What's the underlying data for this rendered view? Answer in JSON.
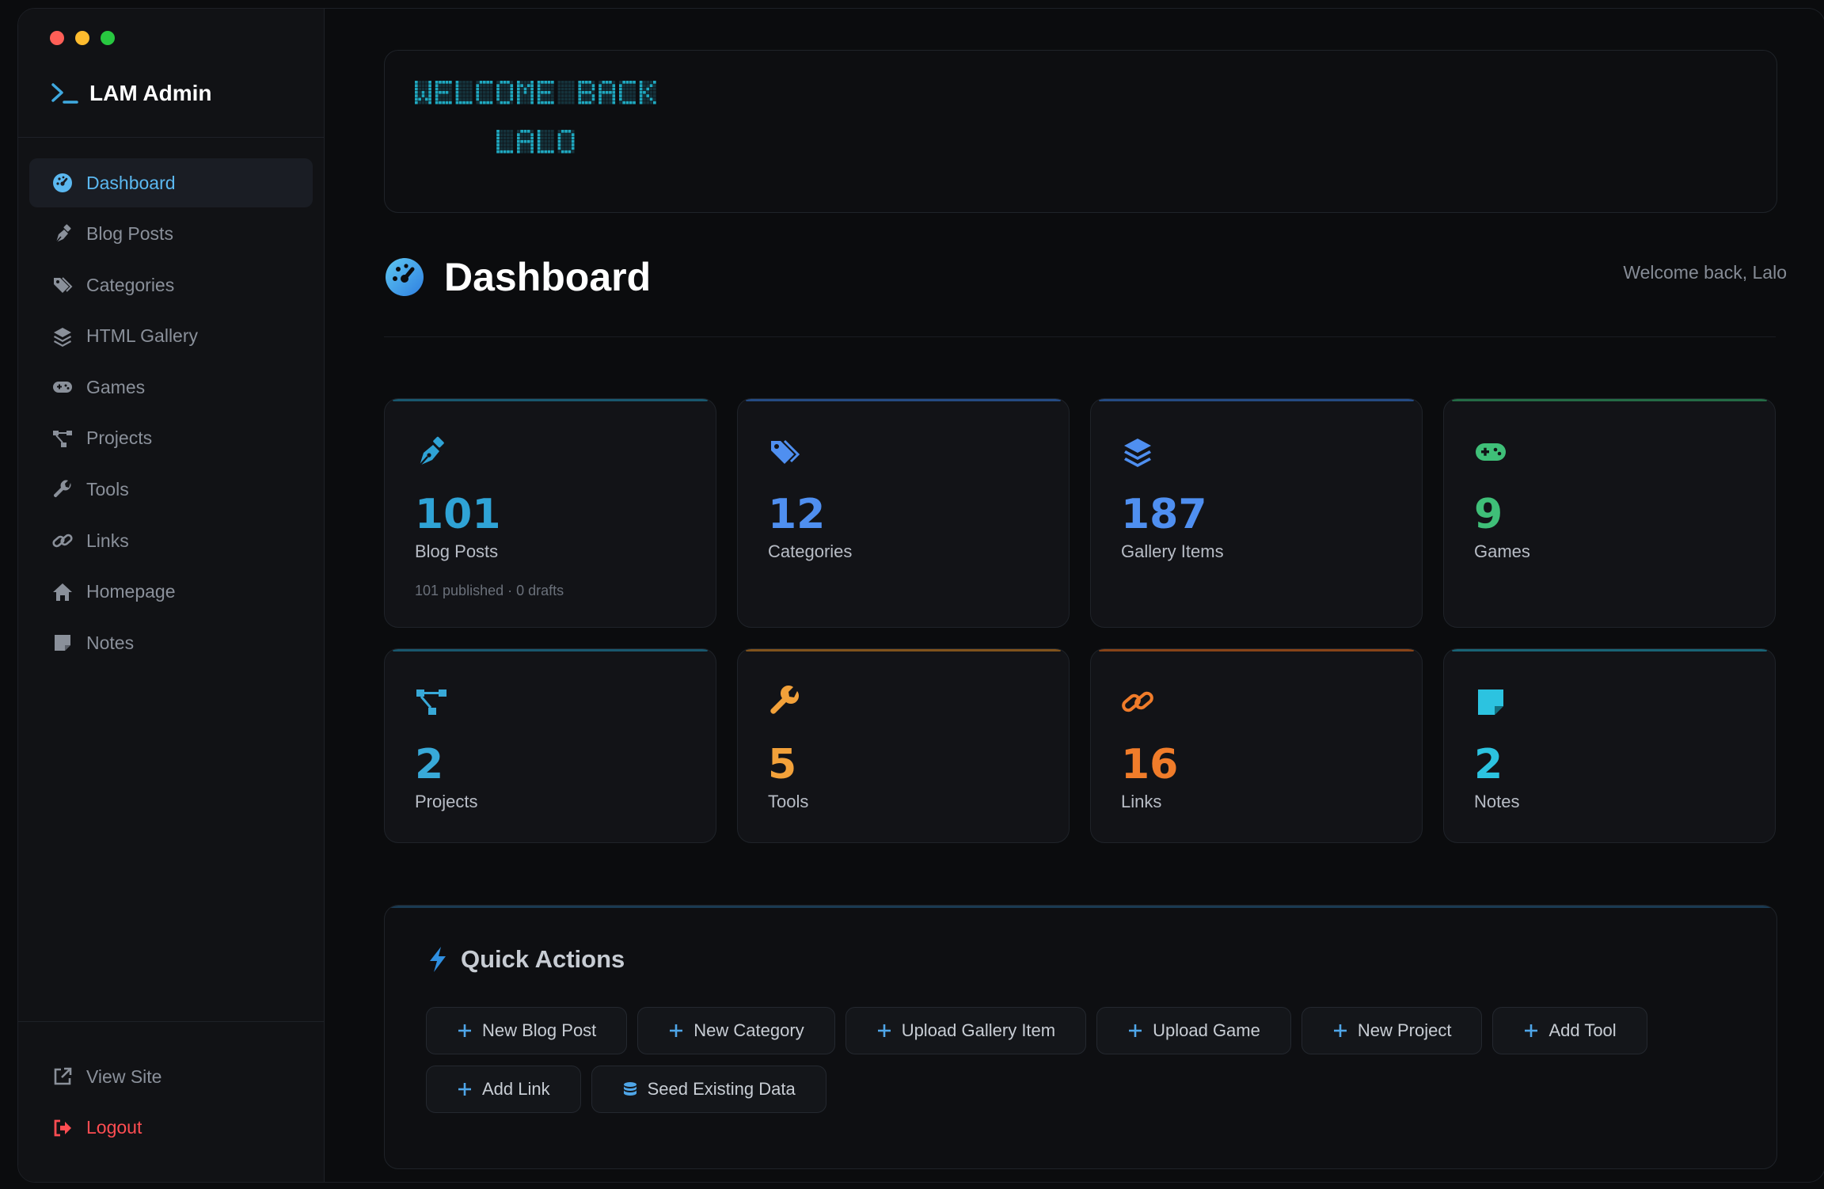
{
  "window": {
    "brand": "LAM Admin"
  },
  "sidebar": {
    "items": [
      {
        "label": "Dashboard",
        "icon": "gauge-icon",
        "active": true
      },
      {
        "label": "Blog Posts",
        "icon": "pen-nib-icon"
      },
      {
        "label": "Categories",
        "icon": "tags-icon"
      },
      {
        "label": "HTML Gallery",
        "icon": "layers-icon"
      },
      {
        "label": "Games",
        "icon": "gamepad-icon"
      },
      {
        "label": "Projects",
        "icon": "diagram-icon"
      },
      {
        "label": "Tools",
        "icon": "wrench-icon"
      },
      {
        "label": "Links",
        "icon": "link-icon"
      },
      {
        "label": "Homepage",
        "icon": "home-icon"
      },
      {
        "label": "Notes",
        "icon": "note-icon"
      }
    ],
    "footer": {
      "view_site": "View Site",
      "logout": "Logout"
    }
  },
  "banner": {
    "line1": "WELCOME BACK",
    "line2": "LALO",
    "color": "#1fa8c0"
  },
  "header": {
    "title": "Dashboard",
    "welcome": "Welcome back, Lalo"
  },
  "stats": [
    {
      "value": "101",
      "label": "Blog Posts",
      "sub": "101 published · 0 drafts",
      "color": "#2fa3d6",
      "accent": "#1c6f8c",
      "icon": "pen-nib-icon"
    },
    {
      "value": "12",
      "label": "Categories",
      "color": "#4f8ff0",
      "accent": "#2c5fa8",
      "icon": "tags-icon"
    },
    {
      "value": "187",
      "label": "Gallery Items",
      "color": "#4f8ff0",
      "accent": "#2c5fa8",
      "icon": "layers-icon"
    },
    {
      "value": "9",
      "label": "Games",
      "color": "#3fbf78",
      "accent": "#2b8a55",
      "icon": "gamepad-icon"
    },
    {
      "value": "2",
      "label": "Projects",
      "color": "#38a9d8",
      "accent": "#1c6f8c",
      "icon": "diagram-icon"
    },
    {
      "value": "5",
      "label": "Tools",
      "color": "#f2a13a",
      "accent": "#a66a1f",
      "icon": "wrench-icon"
    },
    {
      "value": "16",
      "label": "Links",
      "color": "#f07c2a",
      "accent": "#b0561a",
      "icon": "link-icon"
    },
    {
      "value": "2",
      "label": "Notes",
      "color": "#2cc3e0",
      "accent": "#1c7f95",
      "icon": "note-icon"
    }
  ],
  "quick_actions": {
    "title": "Quick Actions",
    "buttons": [
      {
        "label": "New Blog Post",
        "icon": "plus-icon"
      },
      {
        "label": "New Category",
        "icon": "plus-icon"
      },
      {
        "label": "Upload Gallery Item",
        "icon": "plus-icon"
      },
      {
        "label": "Upload Game",
        "icon": "plus-icon"
      },
      {
        "label": "New Project",
        "icon": "plus-icon"
      },
      {
        "label": "Add Tool",
        "icon": "plus-icon"
      },
      {
        "label": "Add Link",
        "icon": "plus-icon"
      },
      {
        "label": "Seed Existing Data",
        "icon": "database-icon"
      }
    ]
  }
}
